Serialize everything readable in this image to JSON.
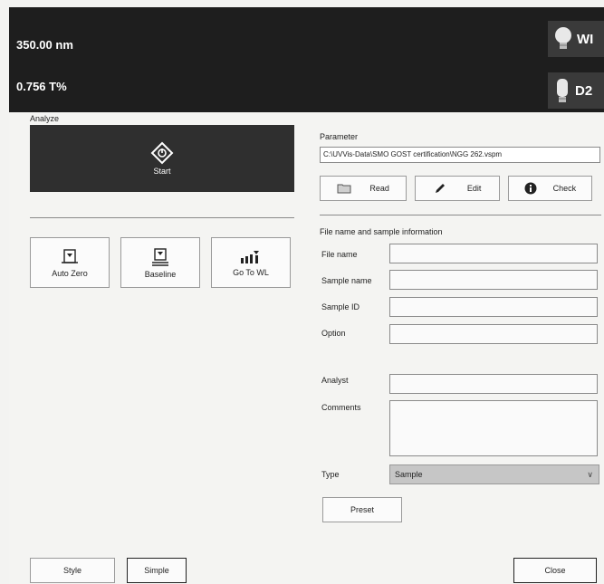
{
  "status": {
    "wavelength": "350.00 nm",
    "transmittance": "0.756 T%",
    "lamp_wi_label": "WI",
    "lamp_d2_label": "D2"
  },
  "analyze": {
    "section_label": "Analyze",
    "start_label": "Start"
  },
  "tools": [
    {
      "label": "Auto Zero",
      "icon": "auto-zero-icon"
    },
    {
      "label": "Baseline",
      "icon": "baseline-icon"
    },
    {
      "label": "Go To WL",
      "icon": "goto-wl-icon"
    }
  ],
  "parameter": {
    "section_label": "Parameter",
    "path": "C:\\UVVis-Data\\SMO GOST certification\\NGG 262.vspm",
    "read_label": "Read",
    "edit_label": "Edit",
    "check_label": "Check"
  },
  "file_info": {
    "section_label": "File name and sample information",
    "file_name_label": "File name",
    "sample_name_label": "Sample name",
    "sample_id_label": "Sample ID",
    "option_label": "Option",
    "analyst_label": "Analyst",
    "comments_label": "Comments",
    "type_label": "Type",
    "type_value": "Sample",
    "preset_label": "Preset"
  },
  "footer": {
    "style_label": "Style",
    "simple_label": "Simple",
    "close_label": "Close"
  }
}
